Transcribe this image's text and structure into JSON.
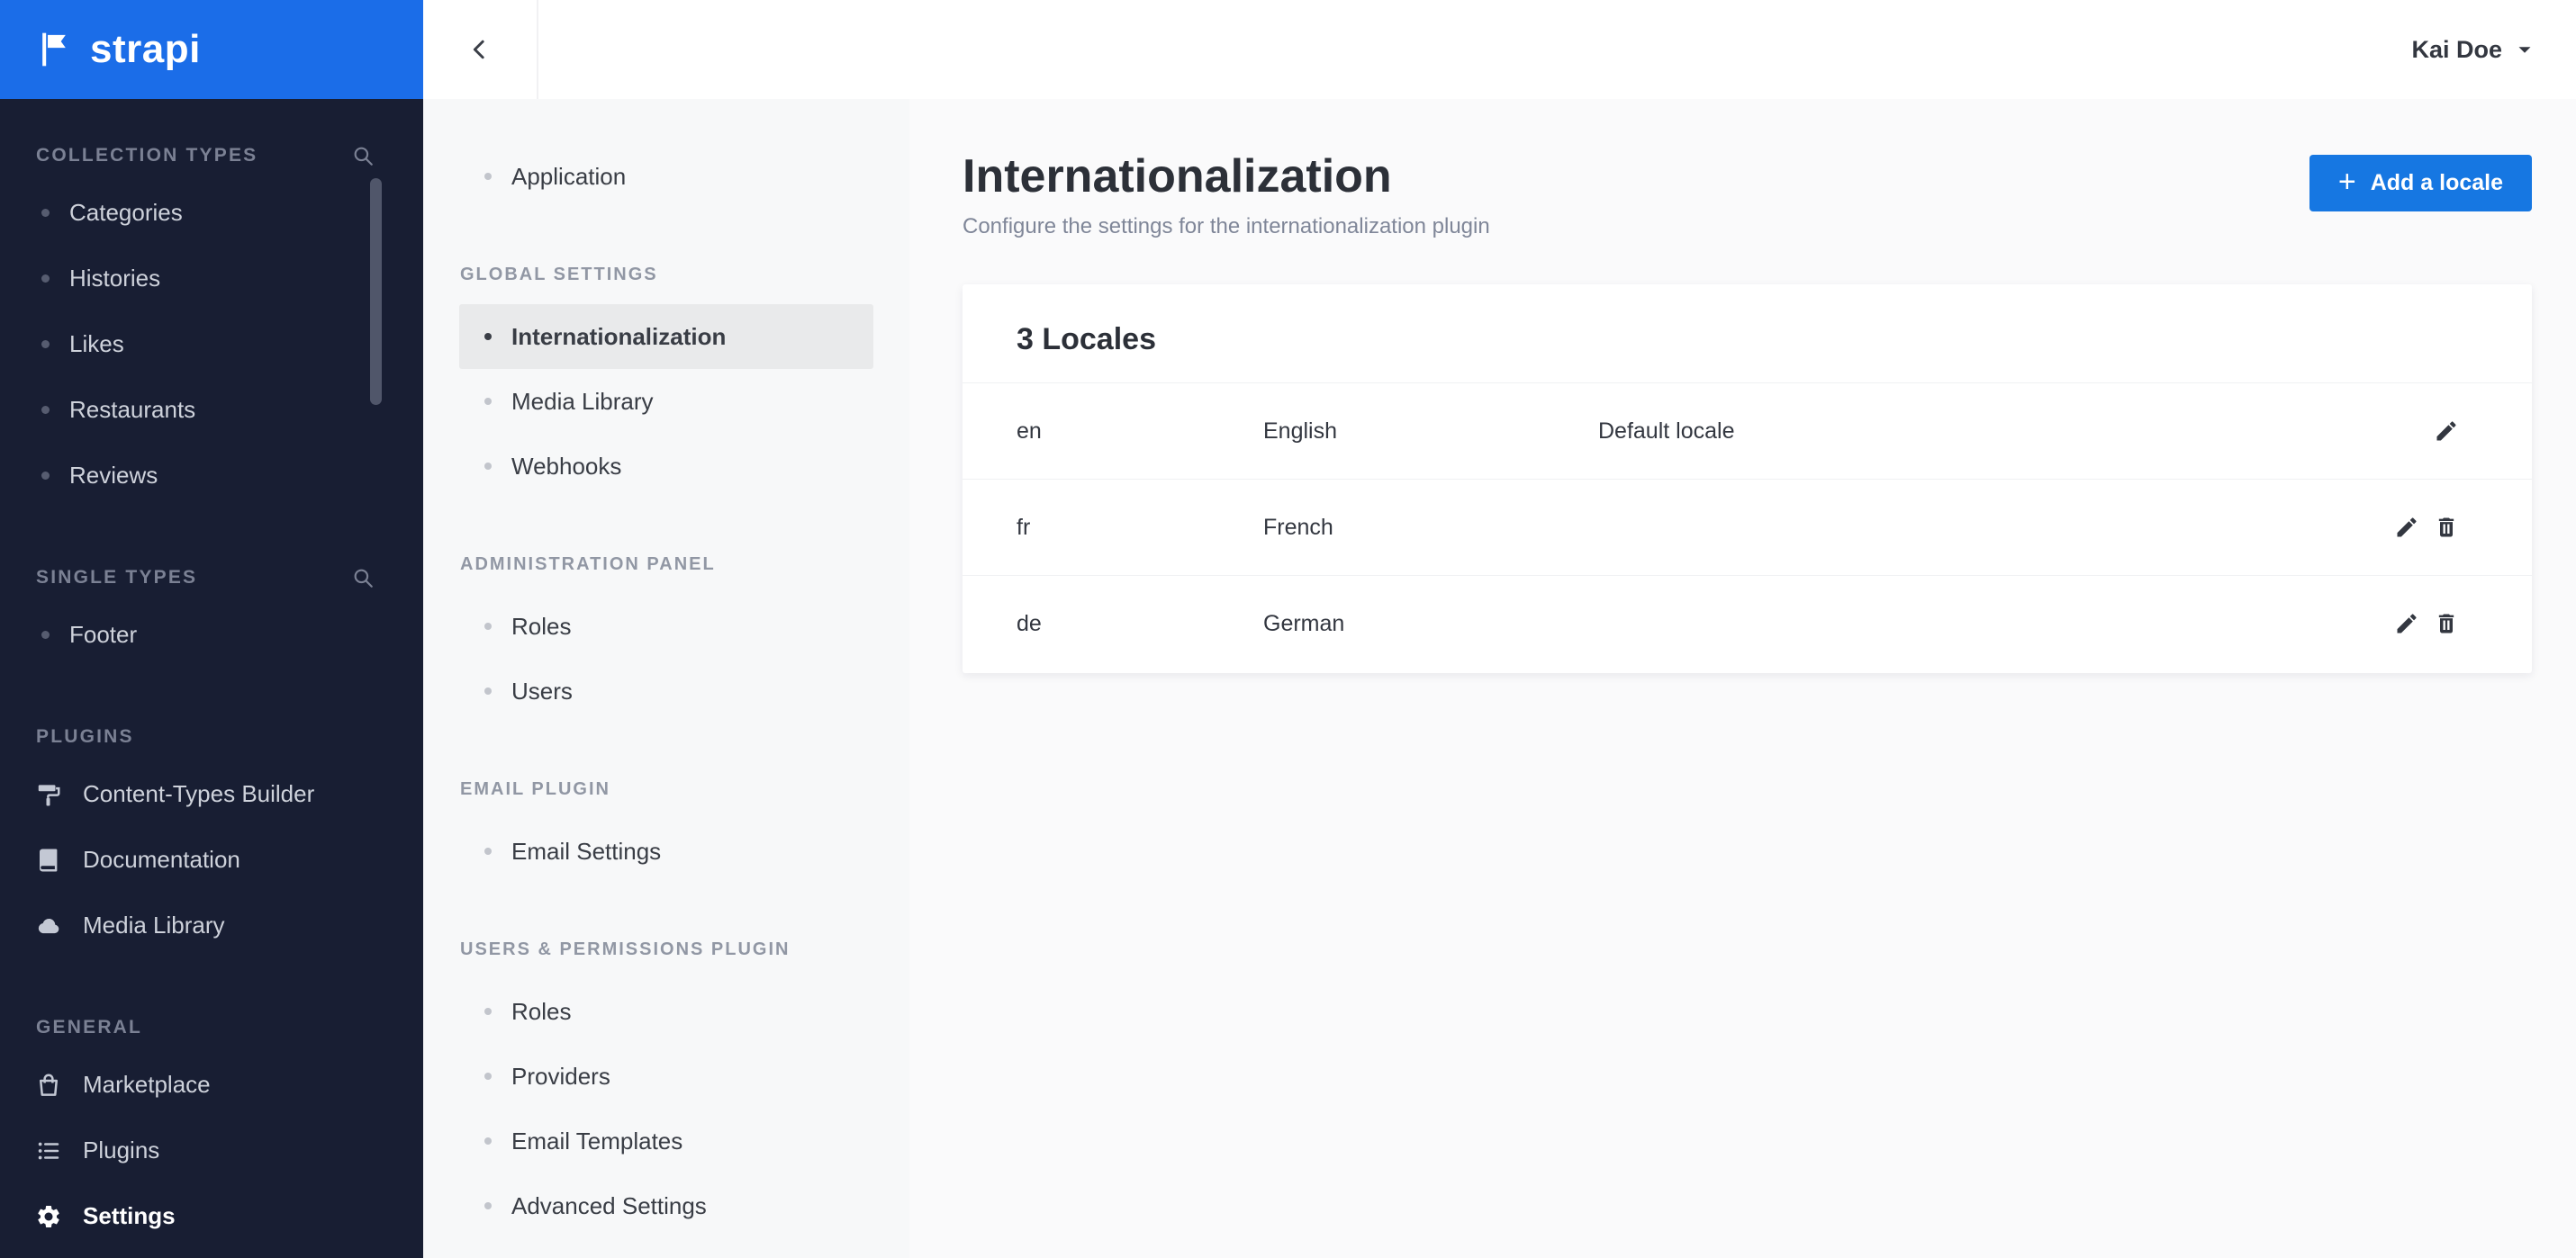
{
  "brand": {
    "logo_text": "strapi"
  },
  "header": {
    "user_name": "Kai Doe"
  },
  "icons": {
    "plus": "+"
  },
  "colors": {
    "logo_blue": "#1b6de8",
    "button_blue": "#1677e2",
    "sidebar_bg": "#181e33",
    "subnav_bg": "#f7f8f9",
    "main_bg": "#fafafb",
    "text": "#333740"
  },
  "sidebar": {
    "sections": [
      {
        "label": "COLLECTION TYPES",
        "has_search": true,
        "items": [
          {
            "label": "Categories"
          },
          {
            "label": "Histories"
          },
          {
            "label": "Likes"
          },
          {
            "label": "Restaurants"
          },
          {
            "label": "Reviews"
          }
        ]
      },
      {
        "label": "SINGLE TYPES",
        "has_search": true,
        "items": [
          {
            "label": "Footer"
          }
        ]
      },
      {
        "label": "PLUGINS",
        "items": [
          {
            "label": "Content-Types Builder",
            "icon": "paint-roller-icon"
          },
          {
            "label": "Documentation",
            "icon": "book-icon"
          },
          {
            "label": "Media Library",
            "icon": "cloud-icon"
          }
        ]
      },
      {
        "label": "GENERAL",
        "items": [
          {
            "label": "Marketplace",
            "icon": "shopping-bag-icon"
          },
          {
            "label": "Plugins",
            "icon": "list-icon"
          },
          {
            "label": "Settings",
            "icon": "gear-icon",
            "active": true
          }
        ]
      }
    ]
  },
  "settings_nav": {
    "top_items": [
      {
        "label": "Application"
      }
    ],
    "groups": [
      {
        "label": "GLOBAL SETTINGS",
        "items": [
          {
            "label": "Internationalization",
            "active": true
          },
          {
            "label": "Media Library"
          },
          {
            "label": "Webhooks"
          }
        ]
      },
      {
        "label": "ADMINISTRATION PANEL",
        "items": [
          {
            "label": "Roles"
          },
          {
            "label": "Users"
          }
        ]
      },
      {
        "label": "EMAIL PLUGIN",
        "items": [
          {
            "label": "Email Settings"
          }
        ]
      },
      {
        "label": "USERS & PERMISSIONS PLUGIN",
        "items": [
          {
            "label": "Roles"
          },
          {
            "label": "Providers"
          },
          {
            "label": "Email Templates"
          },
          {
            "label": "Advanced Settings"
          }
        ]
      }
    ]
  },
  "main": {
    "title": "Internationalization",
    "subtitle": "Configure the settings for the internationalization plugin",
    "add_locale_button": "Add a locale",
    "locales_card": {
      "title": "3 Locales",
      "rows": [
        {
          "code": "en",
          "name": "English",
          "note": "Default locale"
        },
        {
          "code": "fr",
          "name": "French",
          "note": ""
        },
        {
          "code": "de",
          "name": "German",
          "note": ""
        }
      ]
    }
  }
}
